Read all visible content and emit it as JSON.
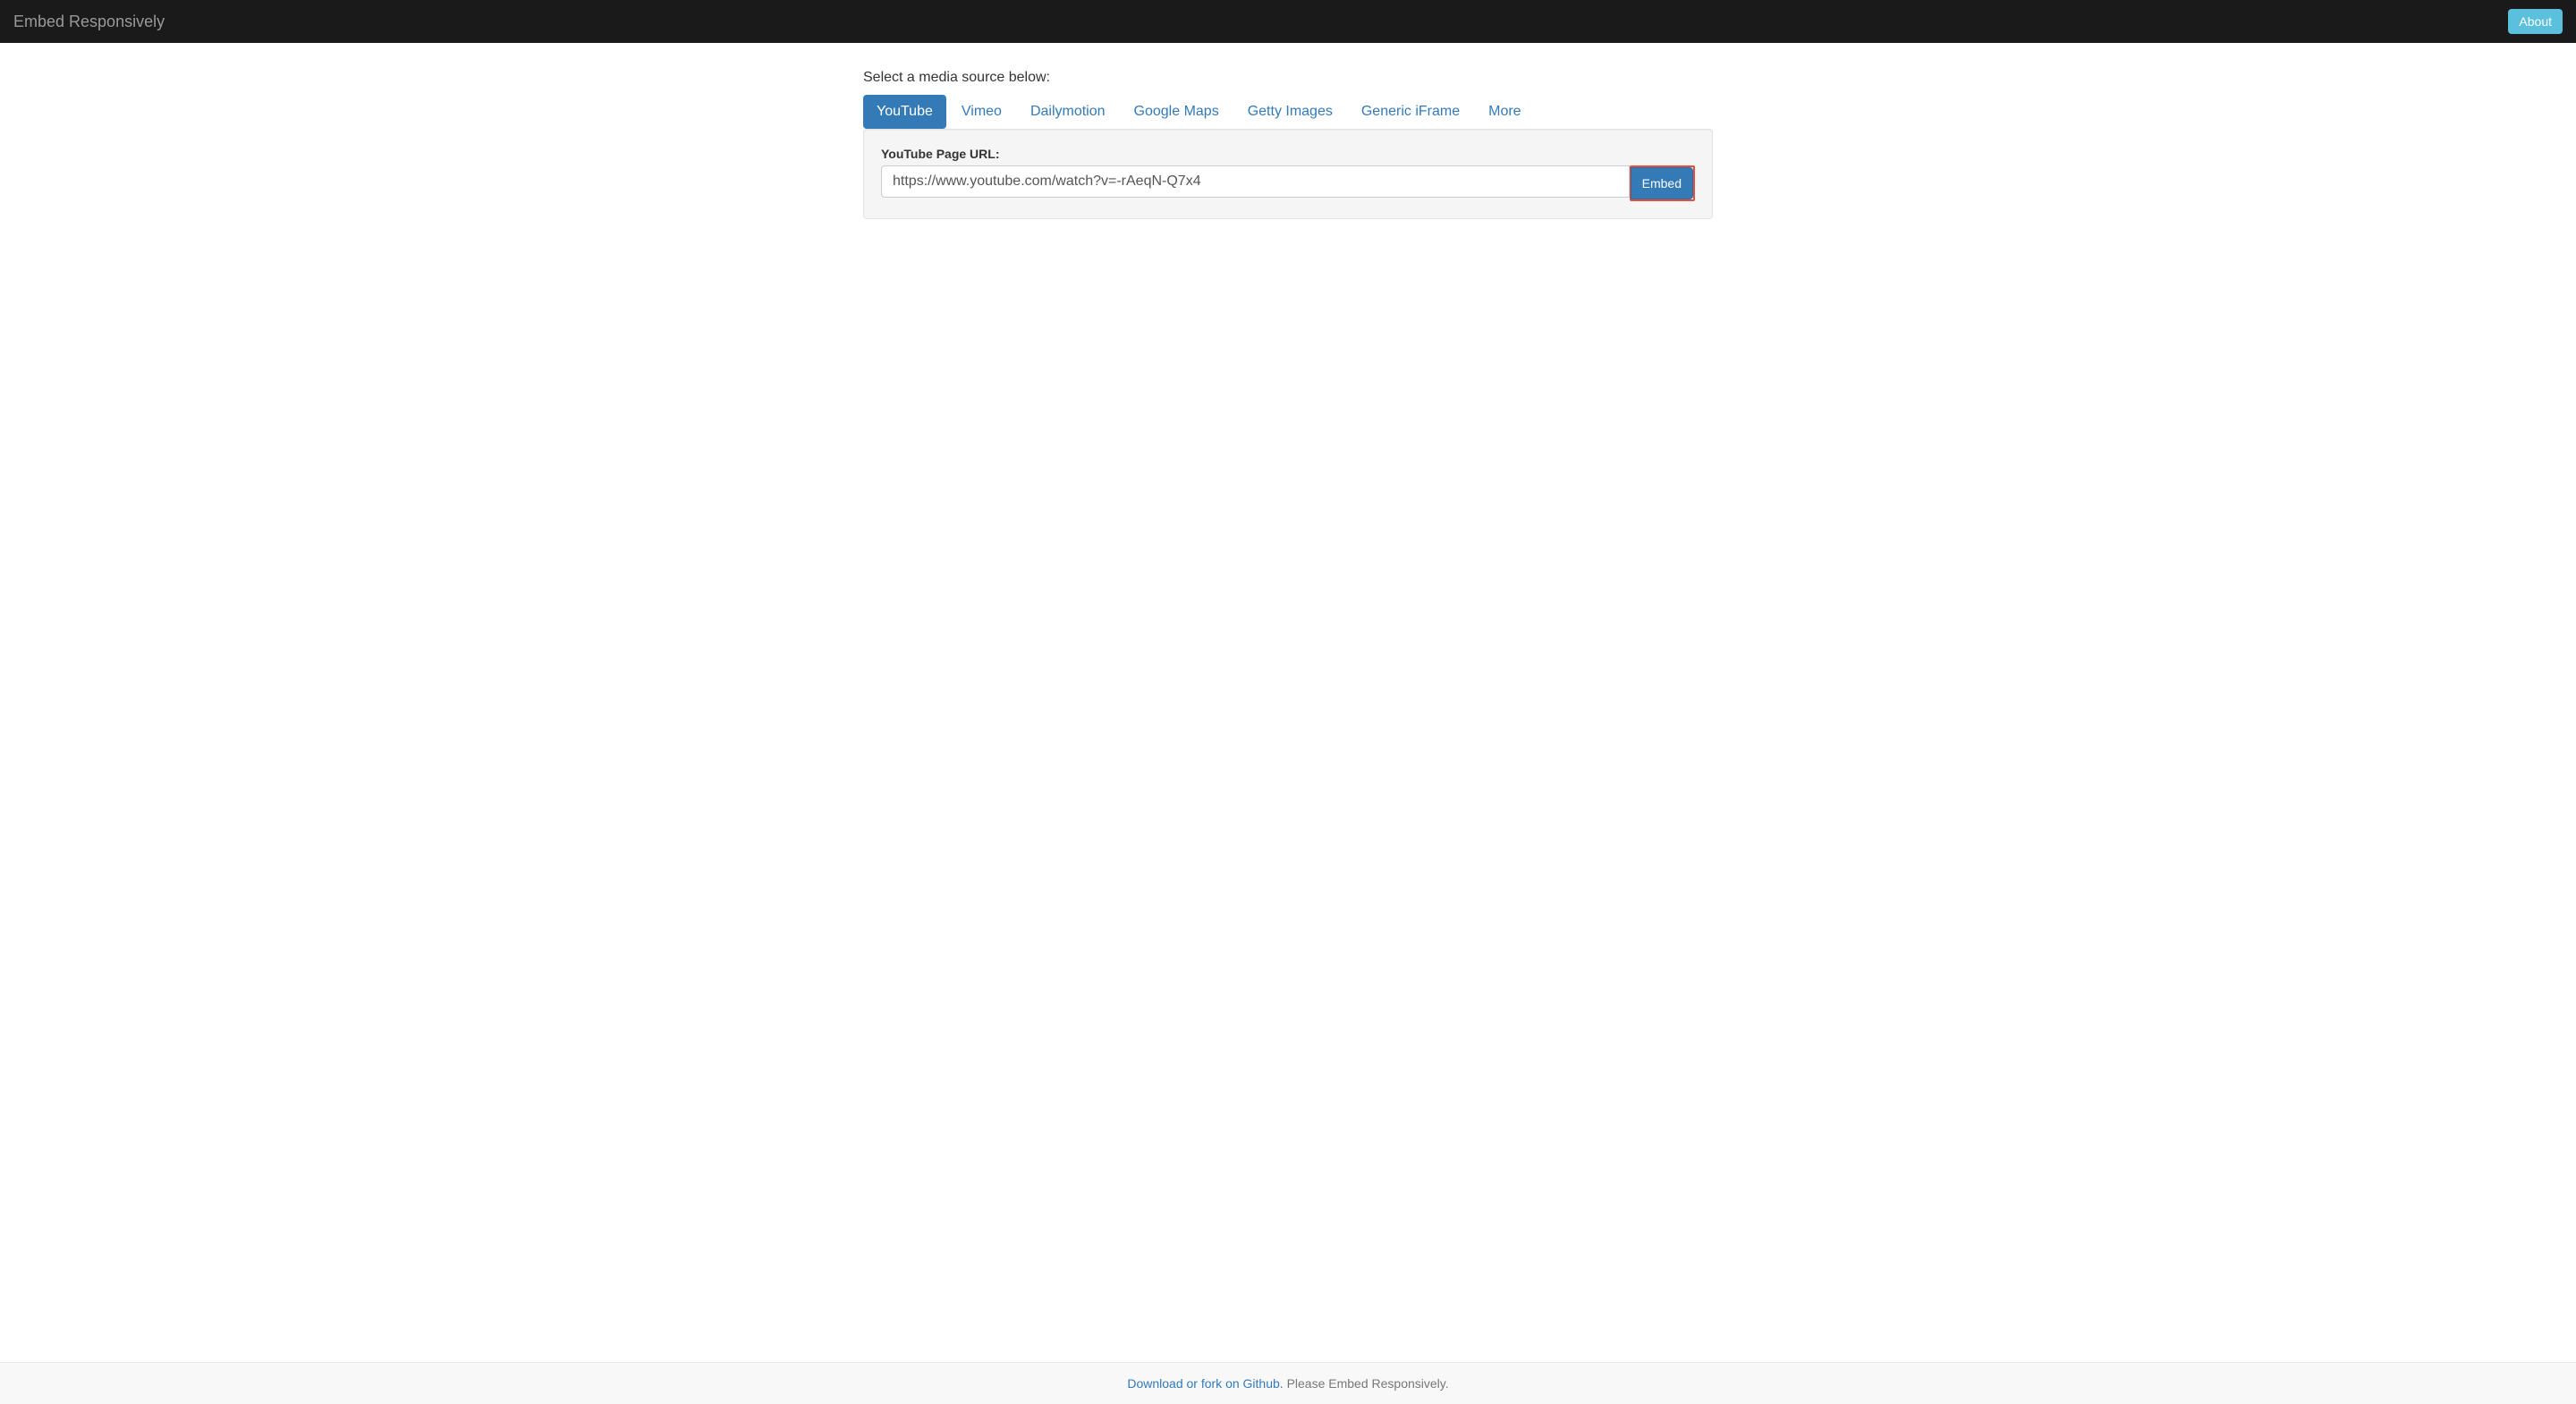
{
  "header": {
    "brand": "Embed Responsively",
    "about_label": "About"
  },
  "main": {
    "prompt": "Select a media source below:",
    "tabs": [
      {
        "label": "YouTube",
        "active": true
      },
      {
        "label": "Vimeo",
        "active": false
      },
      {
        "label": "Dailymotion",
        "active": false
      },
      {
        "label": "Google Maps",
        "active": false
      },
      {
        "label": "Getty Images",
        "active": false
      },
      {
        "label": "Generic iFrame",
        "active": false
      },
      {
        "label": "More",
        "active": false
      }
    ],
    "form": {
      "label": "YouTube Page URL:",
      "value": "https://www.youtube.com/watch?v=-rAeqN-Q7x4",
      "button": "Embed"
    }
  },
  "footer": {
    "link_text": "Download or fork on Github.",
    "tagline": " Please Embed Responsively."
  }
}
